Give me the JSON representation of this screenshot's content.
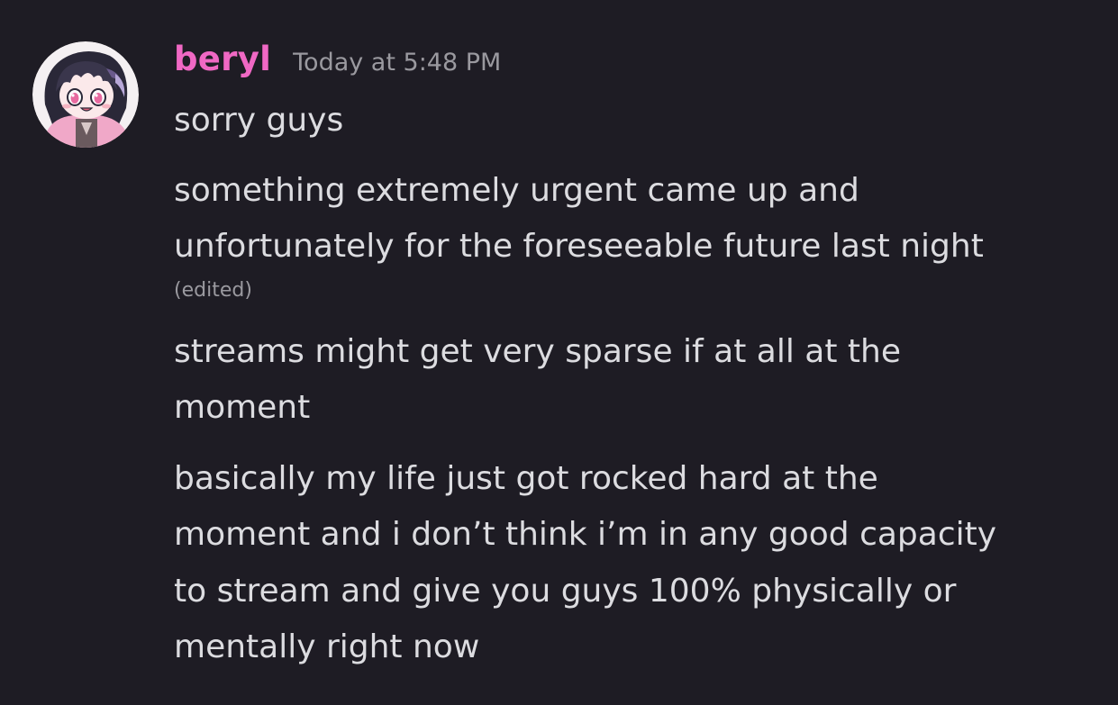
{
  "author": {
    "username": "beryl",
    "timestamp": "Today at 5:48 PM",
    "username_color": "#f068c4",
    "avatar_icon": "chibi-avatar-icon"
  },
  "messages": [
    {
      "lines": [
        "sorry guys"
      ]
    },
    {
      "lines": [
        "something extremely urgent came up and",
        "unfortunately for the foreseeable future last night"
      ],
      "edited_label": "(edited)"
    },
    {
      "lines": [
        "streams might get very sparse if at all at the",
        "moment"
      ]
    },
    {
      "lines": [
        "basically my life just got rocked hard at the",
        "moment and i don’t think i’m in any good capacity",
        "to stream and give you guys 100% physically or",
        "mentally right now"
      ]
    }
  ],
  "colors": {
    "background": "#1e1c24",
    "text": "#dcdce0",
    "muted": "#9a999f"
  }
}
